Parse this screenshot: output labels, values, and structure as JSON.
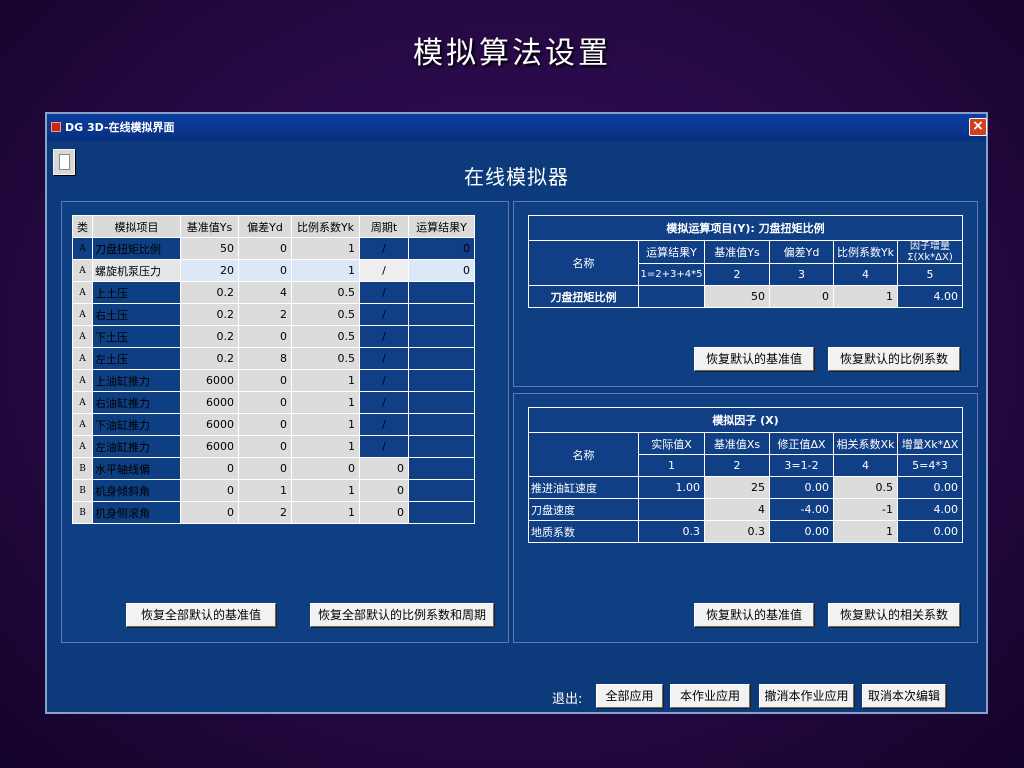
{
  "slide_title": "模拟算法设置",
  "window": {
    "title": "DG 3D-在线模拟界面",
    "heading": "在线模拟器",
    "close": "×"
  },
  "main_table": {
    "headers": [
      "类",
      "模拟项目",
      "基准值Ys",
      "偏差Yd",
      "比例系数Yk",
      "周期t",
      "运算结果Y"
    ],
    "rows": [
      {
        "cat": "A",
        "name": "刀盘扭矩比例",
        "base": "50",
        "dev": "0",
        "ratio": "1",
        "period": "/",
        "result": "0"
      },
      {
        "cat": "A",
        "name": "螺旋机泵压力",
        "base": "20",
        "dev": "0",
        "ratio": "1",
        "period": "/",
        "result": "0"
      },
      {
        "cat": "A",
        "name": "上土压",
        "base": "0.2",
        "dev": "4",
        "ratio": "0.5",
        "period": "/",
        "result": ""
      },
      {
        "cat": "A",
        "name": "右土压",
        "base": "0.2",
        "dev": "2",
        "ratio": "0.5",
        "period": "/",
        "result": ""
      },
      {
        "cat": "A",
        "name": "下土压",
        "base": "0.2",
        "dev": "0",
        "ratio": "0.5",
        "period": "/",
        "result": ""
      },
      {
        "cat": "A",
        "name": "左土压",
        "base": "0.2",
        "dev": "8",
        "ratio": "0.5",
        "period": "/",
        "result": ""
      },
      {
        "cat": "A",
        "name": "上油缸推力",
        "base": "6000",
        "dev": "0",
        "ratio": "1",
        "period": "/",
        "result": ""
      },
      {
        "cat": "A",
        "name": "右油缸推力",
        "base": "6000",
        "dev": "0",
        "ratio": "1",
        "period": "/",
        "result": ""
      },
      {
        "cat": "A",
        "name": "下油缸推力",
        "base": "6000",
        "dev": "0",
        "ratio": "1",
        "period": "/",
        "result": ""
      },
      {
        "cat": "A",
        "name": "左油缸推力",
        "base": "6000",
        "dev": "0",
        "ratio": "1",
        "period": "/",
        "result": ""
      },
      {
        "cat": "B",
        "name": "水平轴线偏",
        "base": "0",
        "dev": "0",
        "ratio": "0",
        "period": "0",
        "result": ""
      },
      {
        "cat": "B",
        "name": "机身倾斜角",
        "base": "0",
        "dev": "1",
        "ratio": "1",
        "period": "0",
        "result": ""
      },
      {
        "cat": "B",
        "name": "机身侧滚角",
        "base": "0",
        "dev": "2",
        "ratio": "1",
        "period": "0",
        "result": ""
      }
    ]
  },
  "left_buttons": {
    "restore_base": "恢复全部默认的基准值",
    "restore_ratio_period": "恢复全部默认的比例系数和周期"
  },
  "top_right": {
    "caption": "模拟运算项目(Y): 刀盘扭矩比例",
    "name_hdr": "名称",
    "col_hdrs": [
      "运算结果Y",
      "基准值Ys",
      "偏差Yd",
      "比例系数Yk",
      "因子增量Σ(Xk*ΔX)"
    ],
    "formula_row": [
      "1=2+3+4*5",
      "2",
      "3",
      "4",
      "5"
    ],
    "row": {
      "name": "刀盘扭矩比例",
      "result": "",
      "base": "50",
      "dev": "0",
      "ratio": "1",
      "inc": "4.00"
    },
    "btn_base": "恢复默认的基准值",
    "btn_ratio": "恢复默认的比例系数"
  },
  "bottom_right": {
    "caption": "模拟因子 (X)",
    "name_hdr": "名称",
    "col_hdrs": [
      "实际值X",
      "基准值Xs",
      "修正值ΔX",
      "相关系数Xk",
      "增量Xk*ΔX"
    ],
    "formula_row": [
      "1",
      "2",
      "3=1-2",
      "4",
      "5=4*3"
    ],
    "rows": [
      {
        "name": "推进油缸速度",
        "actual": "1.00",
        "base": "25",
        "corr": "0.00",
        "coef": "0.5",
        "inc": "0.00"
      },
      {
        "name": "刀盘速度",
        "actual": "",
        "base": "4",
        "corr": "-4.00",
        "coef": "-1",
        "inc": "4.00"
      },
      {
        "name": "地质系数",
        "actual": "0.3",
        "base": "0.3",
        "corr": "0.00",
        "coef": "1",
        "inc": "0.00"
      }
    ],
    "btn_base": "恢复默认的基准值",
    "btn_coef": "恢复默认的相关系数"
  },
  "footer": {
    "exit_label": "退出:",
    "apply_all": "全部应用",
    "apply_job": "本作业应用",
    "cancel_job": "撤消本作业应用",
    "cancel_edit": "取消本次编辑"
  }
}
